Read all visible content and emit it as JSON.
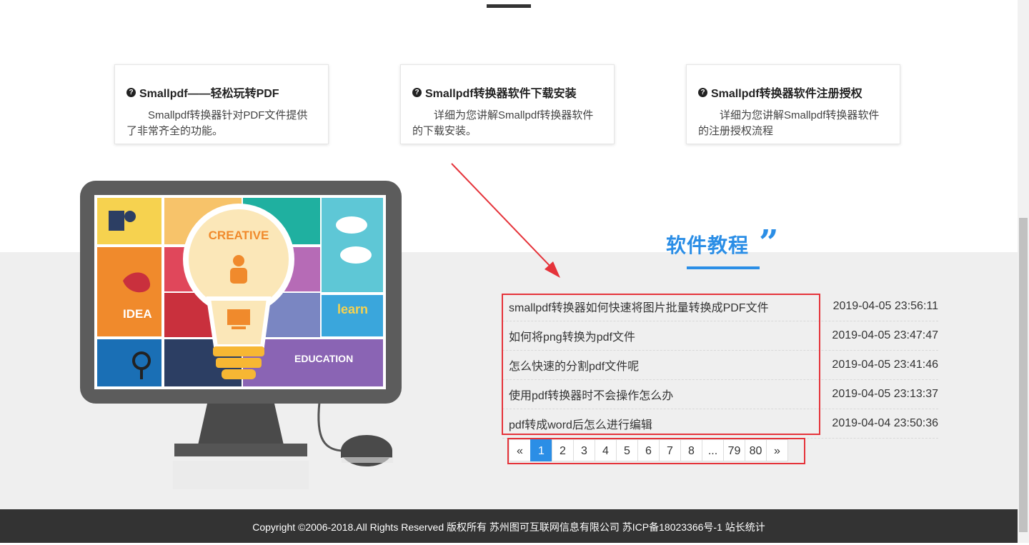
{
  "cards": [
    {
      "title": "Smallpdf——轻松玩转PDF",
      "desc": "Smallpdf转换器针对PDF文件提供了非常齐全的功能。"
    },
    {
      "title": "Smallpdf转换器软件下载安装",
      "desc": "详细为您讲解Smallpdf转换器软件的下载安装。"
    },
    {
      "title": "Smallpdf转换器软件注册授权",
      "desc": "详细为您讲解Smallpdf转换器软件的注册授权流程"
    }
  ],
  "illustration": {
    "creative": "CREATIVE",
    "idea": "IDEA",
    "learn": "learn",
    "education": "EDUCATION"
  },
  "tutorial": {
    "title": "软件教程",
    "items": [
      {
        "title": "smallpdf转换器如何快速将图片批量转换成PDF文件",
        "date": "2019-04-05 23:56:11"
      },
      {
        "title": "如何将png转换为pdf文件",
        "date": "2019-04-05 23:47:47"
      },
      {
        "title": "怎么快速的分割pdf文件呢",
        "date": "2019-04-05 23:41:46"
      },
      {
        "title": "使用pdf转换器时不会操作怎么办",
        "date": "2019-04-05 23:13:37"
      },
      {
        "title": "pdf转成word后怎么进行编辑",
        "date": "2019-04-04 23:50:36"
      }
    ]
  },
  "pagination": {
    "prev": "«",
    "next": "»",
    "pages": [
      "1",
      "2",
      "3",
      "4",
      "5",
      "6",
      "7",
      "8",
      "...",
      "79",
      "80"
    ],
    "active": "1"
  },
  "footer": {
    "text": "Copyright ©2006-2018.All Rights Reserved 版权所有 苏州图可互联网信息有限公司 苏ICP备18023366号-1 站长统计"
  },
  "colors": {
    "accent": "#2b8ee6",
    "highlight": "#e5333a",
    "footer_bg": "#333333"
  }
}
